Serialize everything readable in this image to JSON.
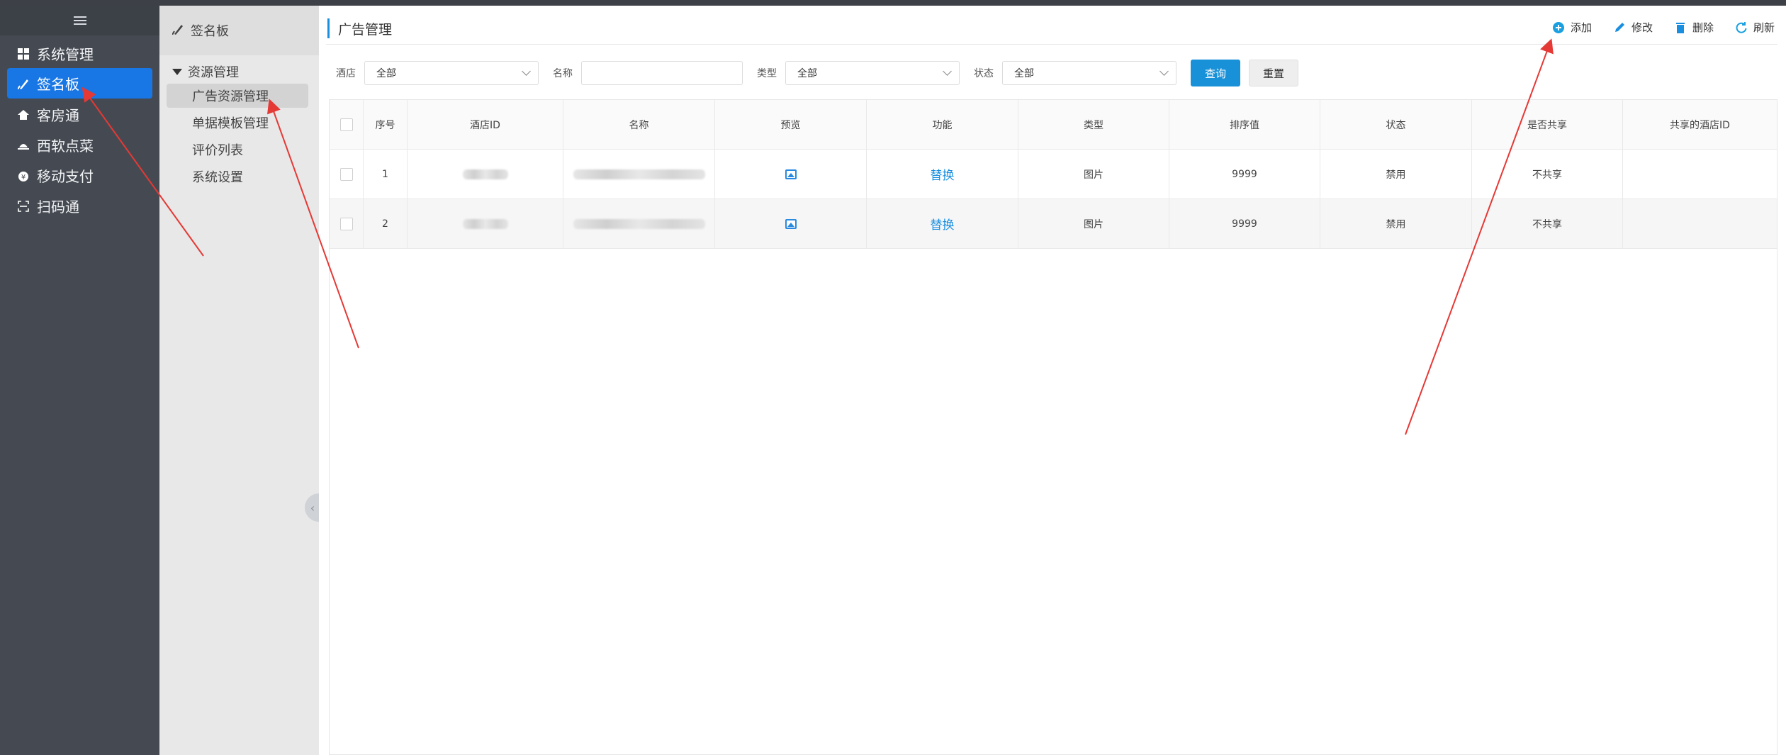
{
  "sidebar": {
    "items": [
      {
        "label": "系统管理",
        "icon": "grid-icon"
      },
      {
        "label": "签名板",
        "icon": "pen-icon",
        "active": true
      },
      {
        "label": "客房通",
        "icon": "home-icon"
      },
      {
        "label": "西软点菜",
        "icon": "dish-icon"
      },
      {
        "label": "移动支付",
        "icon": "payment-icon"
      },
      {
        "label": "扫码通",
        "icon": "scan-icon"
      }
    ]
  },
  "subnav": {
    "header": "签名板",
    "group": "资源管理",
    "items": [
      "广告资源管理",
      "单据模板管理",
      "评价列表",
      "系统设置"
    ],
    "active_index": 0
  },
  "page": {
    "title": "广告管理",
    "actions": {
      "add": "添加",
      "edit": "修改",
      "delete": "删除",
      "refresh": "刷新"
    }
  },
  "filters": {
    "hotel_label": "酒店",
    "hotel_value": "全部",
    "name_label": "名称",
    "name_value": "",
    "type_label": "类型",
    "type_value": "全部",
    "status_label": "状态",
    "status_value": "全部",
    "query_button": "查询",
    "reset_button": "重置"
  },
  "table": {
    "columns": [
      "序号",
      "酒店ID",
      "名称",
      "预览",
      "功能",
      "类型",
      "排序值",
      "状态",
      "是否共享",
      "共享的酒店ID"
    ],
    "rows": [
      {
        "index": "1",
        "function": "替换",
        "type": "图片",
        "sort": "9999",
        "status": "禁用",
        "shared": "不共享",
        "shared_hotel": ""
      },
      {
        "index": "2",
        "function": "替换",
        "type": "图片",
        "sort": "9999",
        "status": "禁用",
        "shared": "不共享",
        "shared_hotel": ""
      }
    ]
  },
  "colors": {
    "accent": "#1876e5",
    "primary_button": "#1891d8",
    "annotation": "#e53935"
  }
}
